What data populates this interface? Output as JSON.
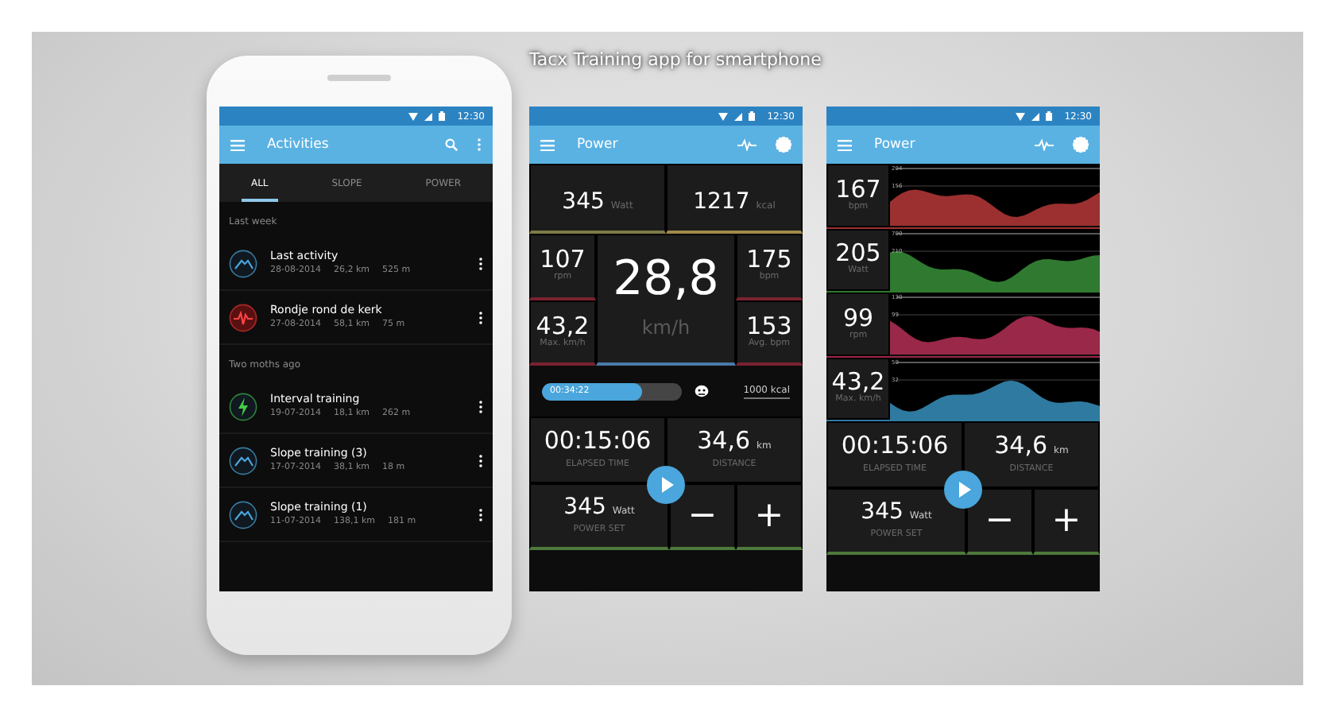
{
  "title": "Tacx Training app for smartphone",
  "screens": [
    {
      "kind": "list",
      "status_time": "12:30",
      "app_title": "Activities",
      "tabs": [
        {
          "label": "ALL",
          "selected": true
        },
        {
          "label": "SLOPE",
          "selected": false
        },
        {
          "label": "POWER",
          "selected": false
        }
      ],
      "sections": [
        {
          "heading": "Last week",
          "items": [
            {
              "kind": "slope",
              "title": "Last activity",
              "date": "28-08-2014",
              "distance": "26,2 km",
              "climb": "525 m"
            },
            {
              "kind": "heart",
              "title": "Rondje rond de kerk",
              "date": "27-08-2014",
              "distance": "58,1 km",
              "climb": "75 m"
            }
          ]
        },
        {
          "heading": "Two moths ago",
          "items": [
            {
              "kind": "interval",
              "title": "Interval training",
              "date": "19-07-2014",
              "distance": "18,1 km",
              "climb": "262 m"
            },
            {
              "kind": "slope",
              "title": "Slope training (3)",
              "date": "17-07-2014",
              "distance": "38,1 km",
              "climb": "18 m"
            },
            {
              "kind": "slope",
              "title": "Slope training (1)",
              "date": "11-07-2014",
              "distance": "138,1 km",
              "climb": "181 m"
            }
          ]
        }
      ]
    },
    {
      "kind": "dashboard",
      "status_time": "12:30",
      "app_title": "Power",
      "top": [
        {
          "value": "345",
          "unit": "Watt"
        },
        {
          "value": "1217",
          "unit": "kcal"
        }
      ],
      "left": [
        {
          "value": "107",
          "unit": "rpm"
        },
        {
          "value": "43,2",
          "unit": "Max. km/h"
        }
      ],
      "center": {
        "value": "28,8",
        "unit": "km/h"
      },
      "right": [
        {
          "value": "175",
          "unit": "bpm"
        },
        {
          "value": "153",
          "unit": "Avg. bpm"
        }
      ],
      "progress": {
        "time": "00:34:22",
        "level": 0.72,
        "goal": "1000 kcal"
      },
      "controls": {
        "elapsed": {
          "value": "00:15:06",
          "label": "ELAPSED TIME"
        },
        "distance": {
          "value": "34,6",
          "unit": "km",
          "label": "DISTANCE"
        },
        "power_set": {
          "value": "345",
          "unit": "Watt",
          "label": "POWER SET"
        },
        "minus": "−",
        "plus": "+"
      }
    },
    {
      "kind": "graphs",
      "status_time": "12:30",
      "app_title": "Power",
      "graphs": [
        {
          "value": "167",
          "unit": "bpm",
          "color": "#9c3030",
          "ticks": [
            "204",
            "156"
          ]
        },
        {
          "value": "205",
          "unit": "Watt",
          "color": "#2f7a30",
          "ticks": [
            "700",
            "210"
          ]
        },
        {
          "value": "99",
          "unit": "rpm",
          "color": "#9a2848",
          "ticks": [
            "130",
            "99"
          ]
        },
        {
          "value": "43,2",
          "unit": "Max. km/h",
          "color": "#2f7aa0",
          "ticks": [
            "50",
            "32"
          ]
        }
      ],
      "controls": {
        "elapsed": {
          "value": "00:15:06",
          "label": "ELAPSED TIME"
        },
        "distance": {
          "value": "34,6",
          "unit": "km",
          "label": "DISTANCE"
        },
        "power_set": {
          "value": "345",
          "unit": "Watt",
          "label": "POWER SET"
        },
        "minus": "−",
        "plus": "+"
      }
    }
  ]
}
